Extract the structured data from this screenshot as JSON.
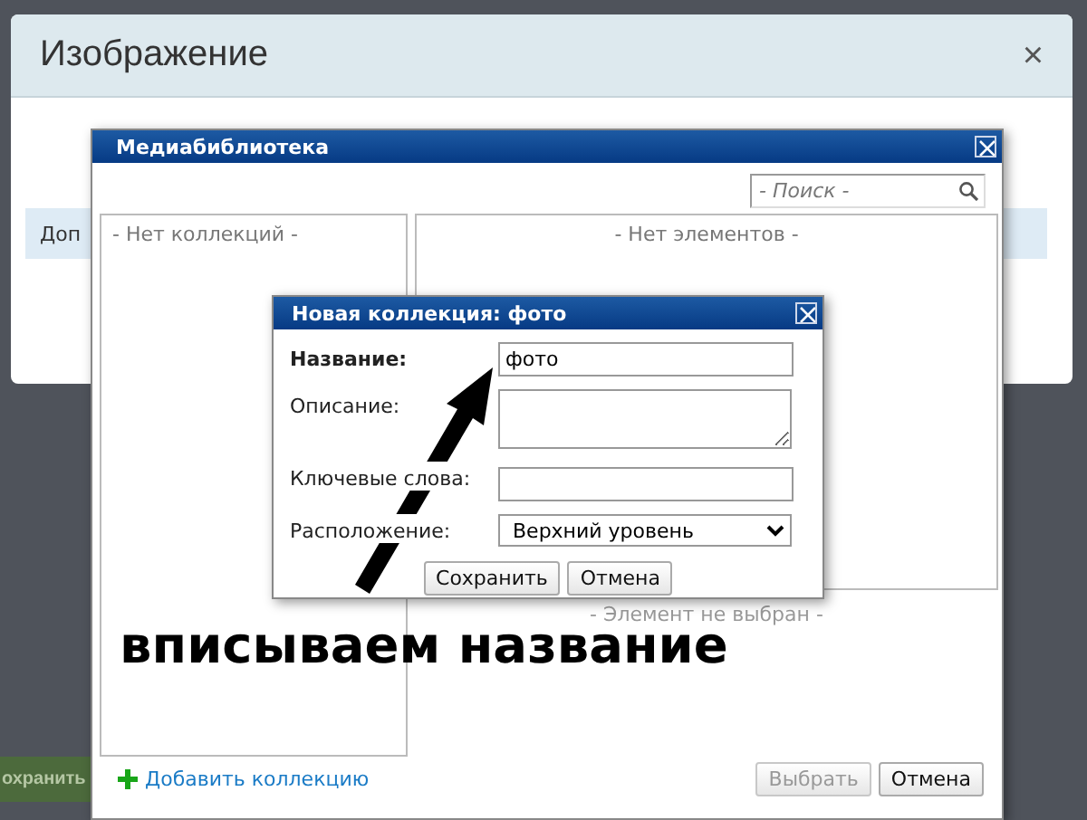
{
  "background_page": {
    "save_button": "охранить"
  },
  "image_modal": {
    "title": "Изображение",
    "close": "×",
    "info_bar": "Доп"
  },
  "media_library": {
    "title": "Медиабиблиотека",
    "search": {
      "placeholder": "- Поиск -"
    },
    "collections_empty": "- Нет коллекций -",
    "elements_empty": "- Нет элементов -",
    "selection_empty": "- Элемент не выбран -",
    "add_collection": "Добавить коллекцию",
    "buttons": [
      {
        "label": "Выбрать",
        "disabled": true
      },
      {
        "label": "Отмена",
        "disabled": false
      }
    ]
  },
  "new_collection": {
    "title": "Новая коллекция: фото",
    "fields": [
      {
        "kind": "text",
        "label": "Название:",
        "bold": true,
        "value": "фото"
      },
      {
        "kind": "textarea",
        "label": "Описание:",
        "bold": false
      },
      {
        "kind": "text",
        "label": "Ключевые слова:",
        "bold": false
      },
      {
        "kind": "select",
        "label": "Расположение:",
        "bold": false,
        "value": "Верхний уровень"
      }
    ],
    "buttons": [
      "Сохранить",
      "Отмена"
    ]
  },
  "annotation": {
    "text": "вписываем название"
  }
}
